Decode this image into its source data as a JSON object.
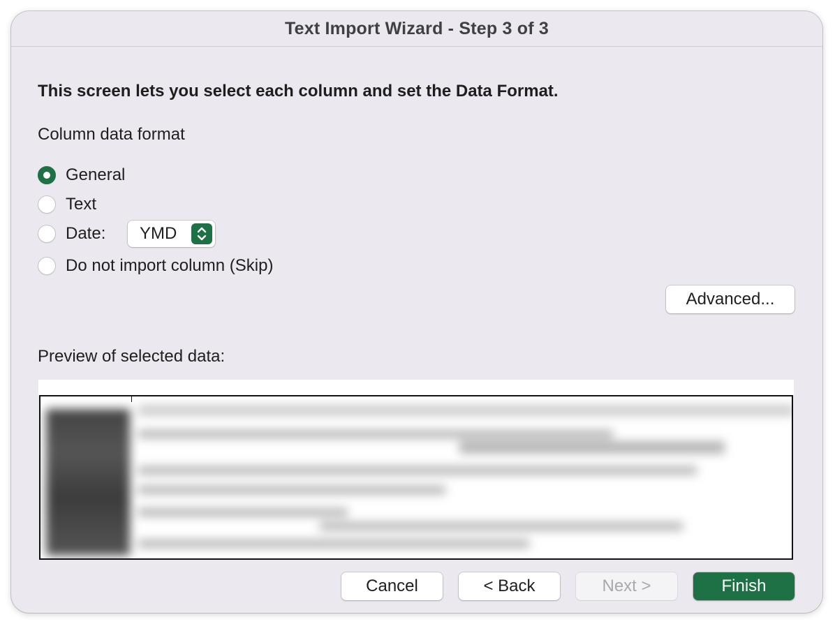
{
  "window": {
    "title": "Text Import Wizard - Step 3 of 3"
  },
  "instructions": "This screen lets you select each column and set the Data Format.",
  "column_format": {
    "label": "Column data format",
    "options": [
      {
        "label": "General",
        "checked": true
      },
      {
        "label": "Text",
        "checked": false
      },
      {
        "label": "Date:",
        "checked": false
      },
      {
        "label": "Do not import column (Skip)",
        "checked": false
      }
    ],
    "date_format": {
      "value": "YMD",
      "icon": "chevron-up-down-icon"
    }
  },
  "advanced_button": "Advanced...",
  "preview": {
    "label": "Preview of selected data:",
    "content_obscured": true
  },
  "footer": {
    "cancel": "Cancel",
    "back": "< Back",
    "next": "Next >",
    "finish": "Finish"
  },
  "colors": {
    "accent": "#1e7145",
    "dialog_background": "#ebe9ef"
  }
}
